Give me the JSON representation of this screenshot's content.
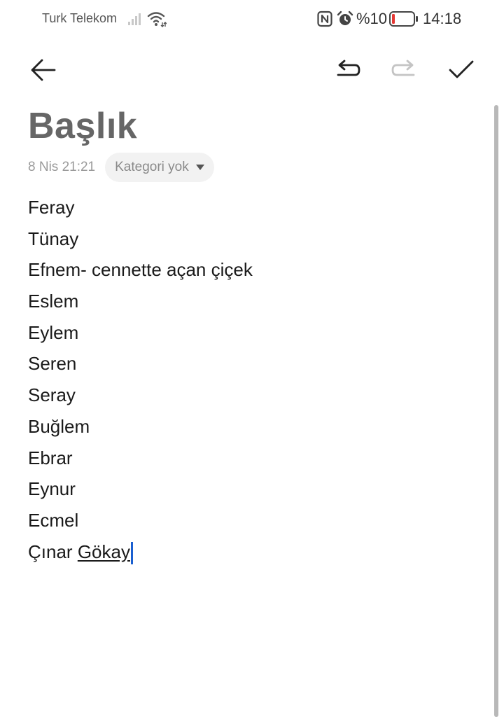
{
  "status_bar": {
    "carrier": "Turk Telekom",
    "battery": "%10",
    "time": "14:18",
    "icons": [
      "signal-icon",
      "wifi-icon",
      "nfc-icon",
      "alarm-icon",
      "battery-icon"
    ],
    "battery_color": "#e53935"
  },
  "toolbar": {
    "icons": [
      "back-arrow-icon",
      "undo-icon",
      "redo-icon",
      "checkmark-icon"
    ]
  },
  "note": {
    "title": "Başlık",
    "date": "8 Nis 21:21",
    "category": "Kategori yok",
    "lines": [
      "Feray",
      "Tünay",
      "Efnem- cennette açan çiçek",
      "Eslem",
      "Eylem",
      "Seren",
      "Seray",
      "Buğlem",
      "Ebrar",
      "Eynur",
      "Ecmel"
    ],
    "last_line_prefix": "Çınar ",
    "last_line_word": "Gökay"
  },
  "colors": {
    "cursor": "#1a5fd0",
    "title": "#666666"
  }
}
